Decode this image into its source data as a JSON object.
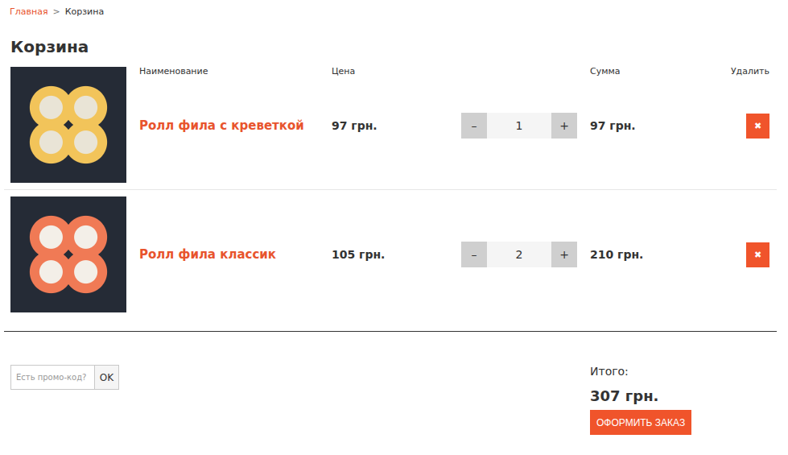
{
  "breadcrumbs": [
    {
      "label": "Главная",
      "selected": false
    },
    {
      "label": "Корзина",
      "selected": true
    }
  ],
  "breadcrumb_separator": ">",
  "title": "Корзина",
  "table": {
    "columns": [
      "Наименование",
      "Цена",
      "Сумма",
      "Удалить"
    ],
    "rows": [
      {
        "name": "Ролл фила с креветкой",
        "price": "97 грн.",
        "minus": "–",
        "quantity": "1",
        "plus": "+",
        "sum": "97 грн.",
        "delete": "✖"
      },
      {
        "name": "Ролл фила классик",
        "price": "105 грн.",
        "minus": "–",
        "quantity": "2",
        "plus": "+",
        "sum": "210 грн.",
        "delete": "✖"
      }
    ]
  },
  "promo": {
    "placeholder": "Есть промо-код?",
    "button": "OK"
  },
  "total": {
    "label": "Итого:",
    "value": "307 грн."
  },
  "checkout_button": "ОФОРМИТЬ ЗАКАЗ"
}
